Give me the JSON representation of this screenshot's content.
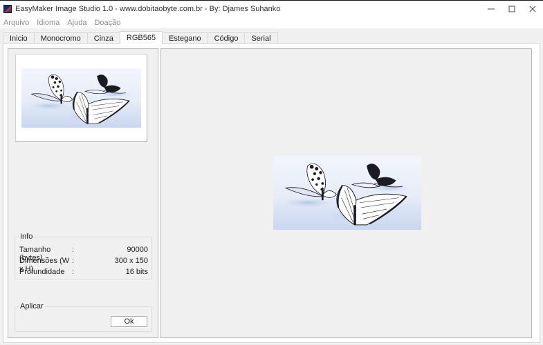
{
  "window": {
    "title": "EasyMaker Image Studio 1.0 - www.dobitaobyte.com.br - By: Djames Suhanko",
    "controls": {
      "minimize_icon": "minimize-icon",
      "maximize_icon": "maximize-icon",
      "close_icon": "close-icon"
    }
  },
  "menu": {
    "items": [
      {
        "label": "Arquivo"
      },
      {
        "label": "Idioma"
      },
      {
        "label": "Ajuda"
      },
      {
        "label": "Doação"
      }
    ]
  },
  "tabs": [
    {
      "label": "Inicio",
      "active": false
    },
    {
      "label": "Monocromo",
      "active": false
    },
    {
      "label": "Cinza",
      "active": false
    },
    {
      "label": "RGB565",
      "active": true
    },
    {
      "label": "Estegano",
      "active": false
    },
    {
      "label": "Código",
      "active": false
    },
    {
      "label": "Serial",
      "active": false
    }
  ],
  "info": {
    "title": "Info",
    "rows": [
      {
        "label": "Tamanho (bytes)",
        "colon": ":",
        "value": "90000"
      },
      {
        "label": "Dimensões (W x H)",
        "colon": ":",
        "value": "300 x 150"
      },
      {
        "label": "Profundidade",
        "colon": ":",
        "value": "16 bits"
      }
    ]
  },
  "apply": {
    "title": "Aplicar",
    "ok_label": "Ok"
  },
  "colors": {
    "image_bg_light": "#eef2fb",
    "image_bg_blue": "#c9d6ef",
    "butterfly_dark": "#1b1b22"
  }
}
